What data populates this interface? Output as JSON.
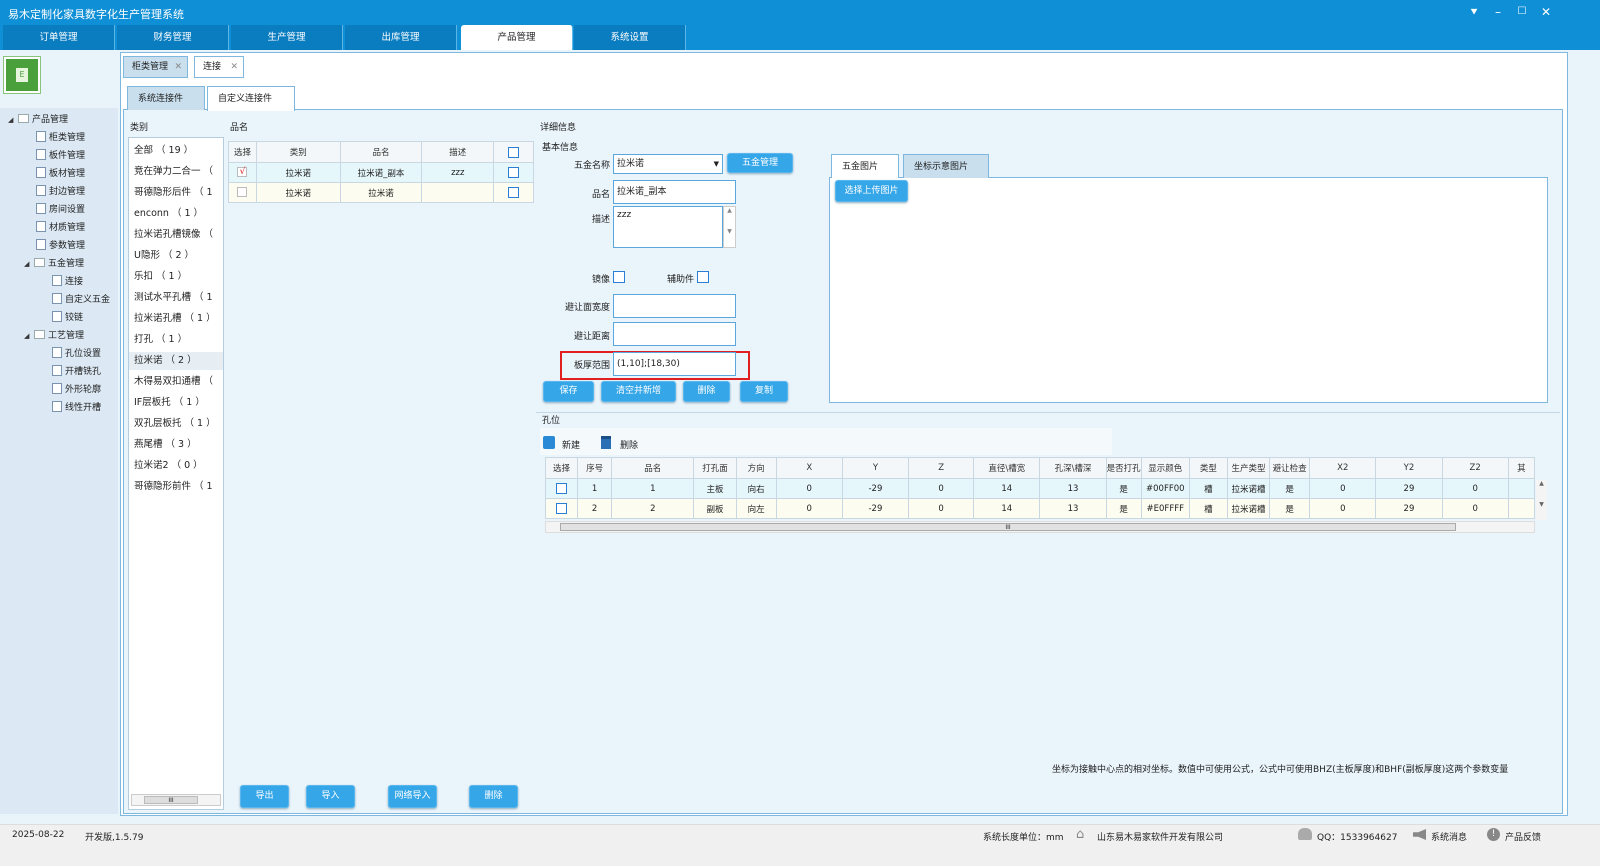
{
  "app": {
    "title": "易木定制化家具数字化生产管理系统",
    "min": "–",
    "max": "☐",
    "close": "✕",
    "menu": "⯆"
  },
  "main_tabs": [
    "订单管理",
    "财务管理",
    "生产管理",
    "出库管理",
    "产品管理",
    "系统设置"
  ],
  "logo_letter": "E",
  "tree": {
    "root": "产品管理",
    "items": [
      "柜类管理",
      "板件管理",
      "板材管理",
      "封边管理",
      "房间设置",
      "材质管理",
      "参数管理"
    ],
    "hw": "五金管理",
    "hw_items": [
      "连接",
      "自定义五金",
      "铰链"
    ],
    "craft": "工艺管理",
    "craft_items": [
      "孔位设置",
      "开槽铣孔",
      "外形轮廓",
      "线性开槽"
    ]
  },
  "doc_tabs": [
    {
      "label": "柜类管理"
    },
    {
      "label": "连接"
    }
  ],
  "sub_tabs": [
    "系统连接件",
    "自定义连接件"
  ],
  "labels": {
    "category": "类别",
    "product": "品名",
    "detail": "详细信息",
    "basic": "基本信息",
    "holes": "孔位"
  },
  "categories": [
    "全部 （ 19 ）",
    "竞在弹力二合一 （",
    "哥德隐形后件 （ 1",
    "enconn （ 1 ）",
    "拉米诺孔槽镜像 （",
    "U隐形 （ 2 ）",
    "乐扣 （ 1 ）",
    "测试水平孔槽 （ 1",
    "拉米诺孔槽 （ 1 ）",
    "打孔 （ 1 ）",
    "拉米诺 （ 2 ）",
    "木得易双扣通槽 （",
    "IF层板托 （ 1 ）",
    "双孔层板托 （ 1 ）",
    "燕尾槽 （ 3 ）",
    "拉米诺2 （ 0 ）",
    "哥德隐形前件 （ 1"
  ],
  "product_grid": {
    "headers": [
      "选择",
      "类别",
      "品名",
      "描述"
    ],
    "rows": [
      {
        "check": "√",
        "cat": "拉米诺",
        "name": "拉米诺_副本",
        "desc": "zzz"
      },
      {
        "check": "",
        "cat": "拉米诺",
        "name": "拉米诺",
        "desc": ""
      }
    ]
  },
  "form": {
    "hw_name_label": "五金名称",
    "hw_name_value": "拉米诺",
    "hw_btn": "五金管理",
    "name_label": "品名",
    "name_value": "拉米诺_副本",
    "desc_label": "描述",
    "desc_value": "zzz",
    "mirror_label": "镜像",
    "aux_label": "辅助件",
    "avoid_w_label": "避让面宽度",
    "avoid_d_label": "避让距离",
    "thick_label": "板厚范围",
    "thick_value": "(1,10];[18,30)"
  },
  "form_buttons": [
    "保存",
    "清空并新增",
    "删除",
    "复制"
  ],
  "img_tabs": [
    "五金图片",
    "坐标示意图片"
  ],
  "upload_btn": "选择上传图片",
  "hole_toolbar": {
    "new": "新建",
    "del": "删除"
  },
  "hole_grid": {
    "headers": [
      "选择",
      "序号",
      "品名",
      "打孔面",
      "方向",
      "X",
      "Y",
      "Z",
      "直径\\槽宽",
      "孔深\\槽深",
      "是否打孔",
      "显示颜色",
      "类型",
      "生产类型",
      "避让检查",
      "X2",
      "Y2",
      "Z2",
      "其"
    ],
    "rows": [
      [
        "",
        "1",
        "1",
        "主板",
        "向右",
        "0",
        "-29",
        "0",
        "14",
        "13",
        "是",
        "#00FF00",
        "槽",
        "拉米诺槽",
        "是",
        "0",
        "29",
        "0",
        ""
      ],
      [
        "",
        "2",
        "2",
        "副板",
        "向左",
        "0",
        "-29",
        "0",
        "14",
        "13",
        "是",
        "#E0FFFF",
        "槽",
        "拉米诺槽",
        "是",
        "0",
        "29",
        "0",
        ""
      ]
    ]
  },
  "hint": "坐标为接触中心点的相对坐标。数值中可使用公式，公式中可使用BHZ(主板厚度)和BHF(副板厚度)这两个参数变量",
  "bottom_buttons": [
    "导出",
    "导入",
    "网络导入",
    "删除"
  ],
  "scroll_mark": "III",
  "status": {
    "date": "2025-08-22",
    "version": "开发版,1.5.79",
    "unit": "系统长度单位：mm",
    "company": "山东易木易家软件开发有限公司",
    "qq": "QQ：1533964627",
    "msg": "系统消息",
    "feedback": "产品反馈"
  }
}
